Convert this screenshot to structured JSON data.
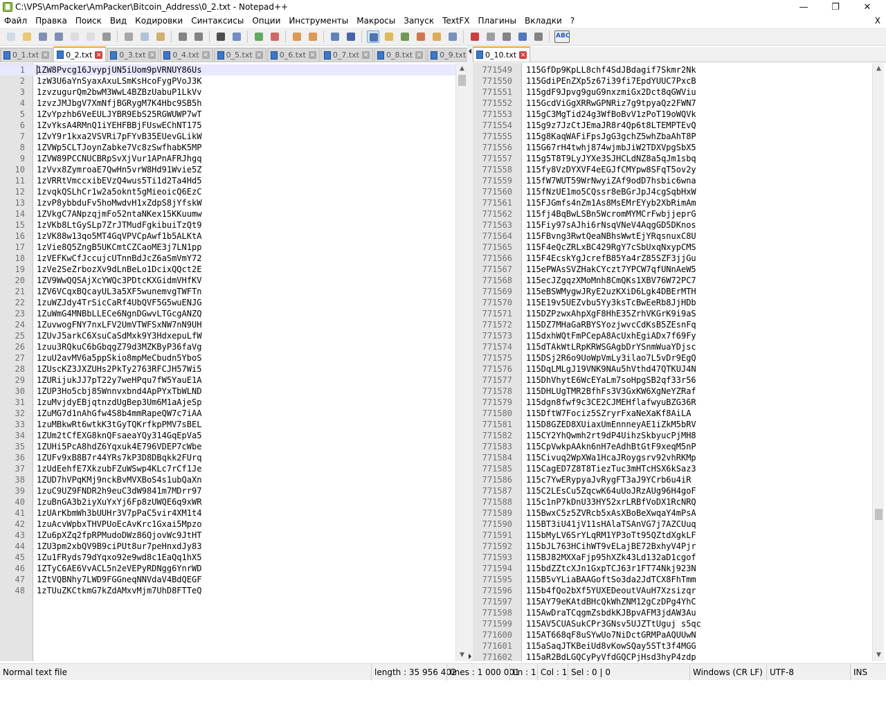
{
  "window": {
    "title": "C:\\VPS\\AmPacker\\AmPacker\\Bitcoin_Address\\0_2.txt - Notepad++",
    "minimize_glyph": "—",
    "maximize_glyph": "❐",
    "close_glyph": "✕"
  },
  "menu": {
    "items": [
      "Файл",
      "Правка",
      "Поиск",
      "Вид",
      "Кодировки",
      "Синтаксисы",
      "Опции",
      "Инструменты",
      "Макросы",
      "Запуск",
      "TextFX",
      "Плагины",
      "Вкладки",
      "?"
    ],
    "close_label": "X"
  },
  "toolbar": {
    "icons": [
      "new-file-icon",
      "open-file-icon",
      "save-icon",
      "save-all-icon",
      "close-icon",
      "close-all-icon",
      "print-icon",
      "|",
      "cut-icon",
      "copy-icon",
      "paste-icon",
      "|",
      "undo-icon",
      "redo-icon",
      "|",
      "find-icon",
      "replace-icon",
      "|",
      "zoom-in-icon",
      "zoom-out-icon",
      "|",
      "sync-vertical-icon",
      "sync-horizontal-icon",
      "|",
      "word-wrap-icon",
      "show-all-chars-icon",
      "|",
      "indent-guide-icon",
      "udl-icon",
      "doc-map-icon",
      "function-list-icon",
      "folder-workspace-icon",
      "monitoring-icon",
      "|",
      "record-macro-icon",
      "stop-macro-icon",
      "play-macro-icon",
      "run-macro-multiple-icon",
      "save-macro-icon",
      "|",
      "spell-check-icon"
    ],
    "icon_colors": {
      "new-file-icon": "#c9d6e8",
      "open-file-icon": "#e8c25a",
      "save-icon": "#6c7fa8",
      "save-all-icon": "#6c7fa8",
      "close-icon": "#d9d9d9",
      "close-all-icon": "#d9d9d9",
      "print-icon": "#8a8a8a",
      "cut-icon": "#9a9a9a",
      "copy-icon": "#a6b8d4",
      "paste-icon": "#c8a25a",
      "undo-icon": "#707070",
      "redo-icon": "#707070",
      "find-icon": "#303030",
      "replace-icon": "#5b7bb8",
      "zoom-in-icon": "#4a9d4a",
      "zoom-out-icon": "#c85050",
      "sync-vertical-icon": "#d9893a",
      "sync-horizontal-icon": "#d9893a",
      "word-wrap-icon": "#4a6fb0",
      "show-all-chars-icon": "#2a4a9a",
      "indent-guide-icon": "#3a5fa8",
      "udl-icon": "#d9b040",
      "doc-map-icon": "#5a8a3a",
      "function-list-icon": "#c86030",
      "folder-workspace-icon": "#d8a040",
      "monitoring-icon": "#6080b0",
      "record-macro-icon": "#c02020",
      "stop-macro-icon": "#909090",
      "play-macro-icon": "#707070",
      "run-macro-multiple-icon": "#3a60b0",
      "save-macro-icon": "#707070"
    },
    "active_icon": "indent-guide-icon",
    "spell_label": "ABC"
  },
  "left_tabs": [
    {
      "label": "0_1.txt",
      "active": false
    },
    {
      "label": "0_2.txt",
      "active": true
    },
    {
      "label": "0_3.txt",
      "active": false
    },
    {
      "label": "0_4.txt",
      "active": false
    },
    {
      "label": "0_5.txt",
      "active": false
    },
    {
      "label": "0_6.txt",
      "active": false
    },
    {
      "label": "0_7.txt",
      "active": false
    },
    {
      "label": "0_8.txt",
      "active": false
    },
    {
      "label": "0_9.txt",
      "active": false
    }
  ],
  "right_tabs": [
    {
      "label": "0_10.txt",
      "active": true
    }
  ],
  "left_editor": {
    "current_line": 1,
    "lines": [
      {
        "n": "1",
        "text": "1ZW8Pvcg16JvypjUN5iUom9pVRNUY86Us"
      },
      {
        "n": "2",
        "text": "1zW3U6aYnSyaxAxuLSmKsHcoFygPVoJ3K"
      },
      {
        "n": "3",
        "text": "1zvzugurQm2bwM3WwL4BZBzUabuP1LkVv"
      },
      {
        "n": "4",
        "text": "1zvzJMJbgV7XmNfjBGRygM7K4Hbc9SB5h"
      },
      {
        "n": "5",
        "text": "1ZvYpzhb6VeEULJYBR9EbS25RGWUWP7wT"
      },
      {
        "n": "6",
        "text": "1ZvYksA4RMnQ1iYEHFBBjFUswEChNT175"
      },
      {
        "n": "7",
        "text": "1ZvY9r1kxa2VSVRi7pFYvB35EUevGLikW"
      },
      {
        "n": "8",
        "text": "1ZVWp5CLTJoynZabke7Vc8zSwfhabK5MP"
      },
      {
        "n": "9",
        "text": "1ZVW89PCCNUCBRpSvXjVur1APnAFRJhgq"
      },
      {
        "n": "10",
        "text": "1zVvx8ZymroaE7QwHn5vrW8Hd91Wvie5Z"
      },
      {
        "n": "11",
        "text": "1zVRRtVmccxibEVzQ4wus5Ti1d2Ta4Hd5"
      },
      {
        "n": "12",
        "text": "1zvqkQSLhCr1w2a5oknt5gMieoicQ6EzC"
      },
      {
        "n": "13",
        "text": "1zvP8ybbduFv5hoMwdvH1xZdpS8jYfskW"
      },
      {
        "n": "14",
        "text": "1ZVkgC7ANpzqjmFo52ntaNKex15KKuumw"
      },
      {
        "n": "15",
        "text": "1zVKb8LtGySLp7ZrJTMudFgkibuiTzQt9"
      },
      {
        "n": "16",
        "text": "1zVK88w13qo5MT4GqVPVCpAwf1b5ALKtA"
      },
      {
        "n": "17",
        "text": "1zVie8Q5ZngB5UKCmtCZCaoME3j7LN1pp"
      },
      {
        "n": "18",
        "text": "1zVEFKwCfJccujcUTnnBdJcZ6aSmVmY72"
      },
      {
        "n": "19",
        "text": "1zVe2SeZrbozXv9dLnBeLo1DcixQQct2E"
      },
      {
        "n": "20",
        "text": "1ZV9WwQQSAjXcYWQc3PDtcKXGidmVHfKV"
      },
      {
        "n": "21",
        "text": "1ZV6VCqxBQcayUL3a5XF5wunemvgTWFTn"
      },
      {
        "n": "22",
        "text": "1zuWZJdy4TrSicCaRf4UbQVF5G5wuENJG"
      },
      {
        "n": "23",
        "text": "1ZuWmG4MNBbLLECe6NgnDGwvLTGcgANZQ"
      },
      {
        "n": "24",
        "text": "1ZuvwogFNY7nxLFV2UmVTWFSxNW7nN9UH"
      },
      {
        "n": "25",
        "text": "1ZUvJ5arkC6XsuCaSdMxk9Y3HdxepuLfW"
      },
      {
        "n": "26",
        "text": "1zuu3RQkuC6bGbqgZ79d3MZKByP36faVg"
      },
      {
        "n": "27",
        "text": "1zuU2avMV6a5ppSkio8mpMeCbudn5YboS"
      },
      {
        "n": "28",
        "text": "1ZUscKZ3JXZUHs2PkTy2763RFCJH57Wi5"
      },
      {
        "n": "29",
        "text": "1ZURijukJJ7pT22y7weHPqu7fW5YauE1A"
      },
      {
        "n": "30",
        "text": "1ZUP3Ho5cbj85Wnnvxbnd4ApPYxTbWLND"
      },
      {
        "n": "31",
        "text": "1zuMvjdyEBjqtnzdUgBep3Um6M1aAjeSp"
      },
      {
        "n": "32",
        "text": "1ZuMG7d1nAhGfw4S8b4mmRapeQW7c7iAA"
      },
      {
        "n": "33",
        "text": "1zuMBkwRt6wtkK3tGyTQKrfkpPMV7sBEL"
      },
      {
        "n": "34",
        "text": "1ZUm2tCfEXG8knQFsaeaYQy314GqEpVa5"
      },
      {
        "n": "35",
        "text": "1ZUHi5PcA8hdZ6Yqxuk4E796VDEP7cWbe"
      },
      {
        "n": "36",
        "text": "1ZUFv9xB8B7r44YRs7kP3D8DBqkk2FUrq"
      },
      {
        "n": "37",
        "text": "1zUdEehfE7XkzubFZuWSwp4KLc7rCf1Je"
      },
      {
        "n": "38",
        "text": "1ZUD7hVPqKMj9nckBvMVXBoS4s1ubQaXn"
      },
      {
        "n": "39",
        "text": "1zuC9UZ9FNDR2h9euC3dW9841m7MDrr97"
      },
      {
        "n": "40",
        "text": "1zuBnGA3b2iyXuYxYj6Fp8zUWQE6q9xWR"
      },
      {
        "n": "41",
        "text": "1zUArKbmWh3bUUHr3V7pPaC5vir4XM1t4"
      },
      {
        "n": "42",
        "text": "1zuAcvWpbxTHVPUoEcAvKrc1Gxai5Mpzo"
      },
      {
        "n": "43",
        "text": "1Zu6pXZq2fpRPMudoDWz86QjovWc9JtHT"
      },
      {
        "n": "44",
        "text": "1ZU3pm2xbQV9B9ciPUt8ur7peHnxdJy83"
      },
      {
        "n": "45",
        "text": "1Zu1FRyds79dYqxo92e9wd8c1EaQq1hX5"
      },
      {
        "n": "46",
        "text": "1ZTyC6AE6VvACL5n2eVEPyRDNgg6YnrWD"
      },
      {
        "n": "47",
        "text": "1ZtVQBNhy7LWD9FGGneqNNVdaV4BdQEGF"
      },
      {
        "n": "48",
        "text": "1zTUuZKCtkmG7kZdAMxvMjm7UhD8FTTeQ"
      }
    ]
  },
  "right_editor": {
    "lines": [
      {
        "n": "771549",
        "text": "115GfDp9KpLL8chf4SdJBdagif7Skmr2Nk"
      },
      {
        "n": "771550",
        "text": "115GdiPEnZXp5z67i39fi7EpdYUUC7PxcB"
      },
      {
        "n": "771551",
        "text": "115gdF9Jpvg9guG9nxzmiGx2Dct8qGWViu"
      },
      {
        "n": "771552",
        "text": "115GcdViGgXRRwGPNRiz7g9tpyaQz2FWN7"
      },
      {
        "n": "771553",
        "text": "115gC3MgTid24g3WfBoBvV1zPoT19oWQVk"
      },
      {
        "n": "771554",
        "text": "115g9z7JzCtJEmaJR8r4Qp6t8LTEMPTEvQ"
      },
      {
        "n": "771555",
        "text": "115g8KaqWAFiFpsJgG3gchZ5whZbaAhT8P"
      },
      {
        "n": "771556",
        "text": "115G67rH4twhj874wjmbJiW2TDXVpgSbX5"
      },
      {
        "n": "771557",
        "text": "115g5T8T9LyJYXe3SJHCLdNZ8a5qJm1sbq"
      },
      {
        "n": "771558",
        "text": "115fy8VzDYXVF4eEGJfCMYpw8SFqT5ov2y"
      },
      {
        "n": "771559",
        "text": "115fW7WUT59WrNwyiZAf9odD7hsbic6wna"
      },
      {
        "n": "771560",
        "text": "115fNzUE1mo5CQssr8eBGrJpJ4cgSqbHxW"
      },
      {
        "n": "771561",
        "text": "115FJGmfs4nZm1As8MsEMrEYyb2XbRimAm"
      },
      {
        "n": "771562",
        "text": "115fj4BqBwLSBn5WcromMYMCrFwbjjeprG"
      },
      {
        "n": "771563",
        "text": "115Fiy97sAJhi6rNsqVNeV4AqgGD5DKnos"
      },
      {
        "n": "771564",
        "text": "115FBvng3RwtQeaNBhsWwtEjYRqsnuxC8U"
      },
      {
        "n": "771565",
        "text": "115F4eQcZRLxBC429RgY7cSbUxqNxypCMS"
      },
      {
        "n": "771566",
        "text": "115F4EcskYgJcrefB85Ya4rZ85SZF3jjGu"
      },
      {
        "n": "771567",
        "text": "115ePWAsSVZHakCYczt7YPCW7qfUNnAeW5"
      },
      {
        "n": "771568",
        "text": "115ecJZgqzXMoMnh8CmQKs1XBV76W72PC7"
      },
      {
        "n": "771569",
        "text": "115eBSWMygwJRyE2uzKXiD6Lgk4DBErMTH"
      },
      {
        "n": "771570",
        "text": "115E19v5UEZvbu5Yy3ksTcBwEeRb8JjHDb"
      },
      {
        "n": "771571",
        "text": "115DZPzwxAhpXgF8HhE35ZrhVKGrK9i9aS"
      },
      {
        "n": "771572",
        "text": "115DZ7MHaGaRBYSYozjwvcCdKsB5ZEsnFq"
      },
      {
        "n": "771573",
        "text": "115dxhWQtFmPCepA8AcUxhEgiADx7f69Fy"
      },
      {
        "n": "771574",
        "text": "115dTAkWtLRpKRWSGAgbDrYSnmWuaYDjsc"
      },
      {
        "n": "771575",
        "text": "115DSj2R6o9UoWpVmLy3ilao7L5vDr9EgQ"
      },
      {
        "n": "771576",
        "text": "115DqLMLgJ19VNK9NAu5hVthd47QTKUJ4N"
      },
      {
        "n": "771577",
        "text": "115DhVhytE6WcEYaLm7soHpgSB2qf33r56"
      },
      {
        "n": "771578",
        "text": "115DHLUgTMR2BfhFs3V3GxKW6XgNeYZRaf"
      },
      {
        "n": "771579",
        "text": "115dgn8fwf9c3CE2CJMEHflafwyuBZG36R"
      },
      {
        "n": "771580",
        "text": "115DftW7Fociz5SZryrFxaNeXaKf8AiLA"
      },
      {
        "n": "771581",
        "text": "115D8GZED8XUiaxUmEnnneyAE1iZkM5bRV"
      },
      {
        "n": "771582",
        "text": "115CY2YhQwmh2rt9dP4UihzSkbyucPjMH8"
      },
      {
        "n": "771583",
        "text": "115CpVwkpAAkn6nH7eAdhBtGtF9xeqM5nP"
      },
      {
        "n": "771584",
        "text": "115Civuq2WpXWa1HcaJRoygsrv92vhRKMp"
      },
      {
        "n": "771585",
        "text": "115CagED7Z8T8TiezTuc3mHTcHSX6kSaz3"
      },
      {
        "n": "771586",
        "text": "115c7YwERypyaJvRygFT3aJ9YCrb6u4iR"
      },
      {
        "n": "771587",
        "text": "115C2LEsCu5ZqcwK64uUoJRzAUg96H4goF"
      },
      {
        "n": "771588",
        "text": "115c1nP7kDnU33HY52xrLRBfVoDX1RcNRQ"
      },
      {
        "n": "771589",
        "text": "115BwxC5z5ZVRcb5xAsXBoBeXwqaY4mPsA"
      },
      {
        "n": "771590",
        "text": "115BT3iU41jV11sHAlaTSAnVG7j7AZCUuq"
      },
      {
        "n": "771591",
        "text": "115bMyLV6SrYLqRM1YP3oTt95QZtdXgkLF"
      },
      {
        "n": "771592",
        "text": "115bJL763HCihWT9vELajBE72BxhyV4Pjr"
      },
      {
        "n": "771593",
        "text": "115BJ82MXXaFjp95hXZk43Ld132aD1cgof"
      },
      {
        "n": "771594",
        "text": "115bdZZtcXJn1GxpTCJ63r1FT74Nkj923N"
      },
      {
        "n": "771595",
        "text": "115B5vYLiaBAAGoftSo3da2JdTCX8FhTmm"
      },
      {
        "n": "771596",
        "text": "115b4fQo2bXf5YUXEDeoutVAuH7Xzsizqr"
      },
      {
        "n": "771597",
        "text": "115AY79eKAtdBHcQkWhZNM12gCzDPg4YhC"
      },
      {
        "n": "771598",
        "text": "115AwDraTCqgmZsbdkKJBpvAFM3jdAW3Au"
      },
      {
        "n": "771599",
        "text": "115AV5CUASukCPr3GNsv5UJZTtUguj s5qc"
      },
      {
        "n": "771600",
        "text": "115AT668qF8uSYwUo7NiDctGRMPaAQUUwN"
      },
      {
        "n": "771601",
        "text": "115aSaqJTKBeiUd8vKowSQay5STt3f4MGG"
      },
      {
        "n": "771602",
        "text": "115aR2BdLGQCyPyVfdGQCPjHsd3hyP4zdp"
      }
    ]
  },
  "scroll": {
    "left_position_fraction": 0.0,
    "right_position_fraction": 0.77
  },
  "status": {
    "file_type": "Normal text file",
    "length": "length : 35 956 402",
    "lines": "lines : 1 000 001",
    "ln": "Ln : 1",
    "col": "Col : 1",
    "sel": "Sel : 0 | 0",
    "eol": "Windows (CR LF)",
    "encoding": "UTF-8",
    "mode": "INS"
  }
}
